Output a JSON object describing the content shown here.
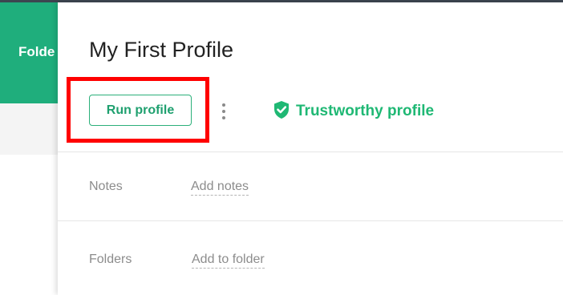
{
  "background": {
    "sidebar_label": "Folde"
  },
  "panel": {
    "title": "My First Profile",
    "run_button_label": "Run profile",
    "trust_status": "Trustworthy profile",
    "fields": [
      {
        "label": "Notes",
        "action": "Add notes"
      },
      {
        "label": "Folders",
        "action": "Add to folder"
      }
    ]
  },
  "icons": {
    "more": "vertical-dots-icon",
    "trust": "shield-check-icon"
  },
  "colors": {
    "brand_green": "#1fae7c",
    "trust_green": "#1fb874",
    "highlight_red": "#ff0000"
  }
}
